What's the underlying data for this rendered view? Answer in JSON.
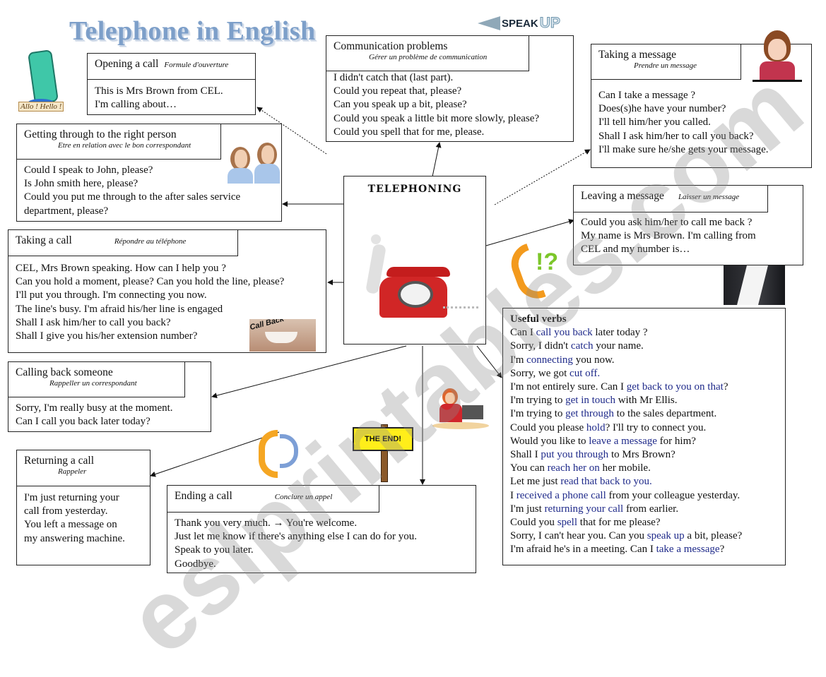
{
  "title": "Telephone in English",
  "mascot_label": "Allo ! Hello !",
  "speak_up": {
    "part1": "SPEAK",
    "part2": "UP"
  },
  "center": {
    "title": "TELEPHONING"
  },
  "call_back_label": "Call Back",
  "the_end_label": "THE END!",
  "watermark": "eslprintables.com",
  "sections": {
    "opening": {
      "title": "Opening a call",
      "french": "Formule d'ouverture",
      "lines": [
        "This is Mrs Brown from CEL.",
        "I'm calling about…"
      ]
    },
    "communication": {
      "title": "Communication problems",
      "french": "Gérer un problème de communication",
      "lines": [
        "I didn't catch that (last part).",
        "Could you repeat that, please?",
        "Can you speak up a bit, please?",
        "Could you speak a little bit more slowly, please?",
        "Could you spell that for me, please."
      ]
    },
    "taking_message": {
      "title": "Taking a message",
      "french": "Prendre un message",
      "lines": [
        "Can I take a message ?",
        "Does(s)he have your number?",
        "I'll tell him/her you called.",
        "Shall I ask him/her to call you back?",
        "I'll make sure he/she gets your message."
      ]
    },
    "getting_through": {
      "title": "Getting through to the right person",
      "french": "Etre en relation avec le bon correspondant",
      "lines": [
        "Could I speak to John, please?",
        "Is John smith here, please?",
        "Could you put me through to the after sales service",
        "department, please?"
      ]
    },
    "leaving_message": {
      "title": "Leaving a message",
      "french": "Laisser un message",
      "lines": [
        "Could you ask him/her to call me back ?",
        "My name is Mrs Brown. I'm calling from",
        "CEL and my number is…"
      ]
    },
    "taking_call": {
      "title": "Taking a call",
      "french": "Répondre au téléphone",
      "lines": [
        "CEL, Mrs Brown speaking. How can I help you ?",
        "Can you hold a moment, please? Can you hold the line, please?",
        "I'll put you through. I'm connecting you now.",
        "The line's busy. I'm afraid his/her line is engaged",
        "Shall I ask him/her to call you back?",
        "Shall I give you his/her extension number?"
      ]
    },
    "calling_back": {
      "title": "Calling back someone",
      "french": "Rappeller un correspondant",
      "lines": [
        "Sorry, I'm really busy at the moment.",
        "Can I call you back later today?"
      ]
    },
    "returning": {
      "title": "Returning a call",
      "french": "Rappeler",
      "lines": [
        "I'm just returning your",
        "call from yesterday.",
        "You left a message on",
        "my answering machine."
      ]
    },
    "ending": {
      "title": "Ending a call",
      "french": "Conclure un appel",
      "lines": [
        "Thank you very much. → You're welcome.",
        "Just let me know if there's anything else I can do for you.",
        "Speak to you later.",
        "Goodbye."
      ]
    },
    "useful_verbs": {
      "title": "Useful verbs",
      "lines": [
        {
          "pre": "Can I ",
          "hl": "call you back",
          "post": " later today ?"
        },
        {
          "pre": "Sorry, I didn't ",
          "hl": "catch",
          "post": " your name."
        },
        {
          "pre": "I'm ",
          "hl": "connecting",
          "post": " you now."
        },
        {
          "pre": "Sorry, we got ",
          "hl": "cut off.",
          "post": ""
        },
        {
          "pre": "I'm not entirely sure. Can I ",
          "hl": "get back to you on that",
          "post": "?"
        },
        {
          "pre": "I'm trying to ",
          "hl": "get in touch",
          "post": " with Mr Ellis."
        },
        {
          "pre": "I'm trying to ",
          "hl": "get through",
          "post": " to the sales department."
        },
        {
          "pre": "Could you please ",
          "hl": "hold",
          "post": "? I'll try to connect you."
        },
        {
          "pre": "Would you like to ",
          "hl": "leave a message",
          "post": " for him?"
        },
        {
          "pre": "Shall I ",
          "hl": "put you through",
          "post": " to Mrs Brown?"
        },
        {
          "pre": "You can ",
          "hl": "reach her on",
          "post": " her mobile."
        },
        {
          "pre": "Let me just ",
          "hl": "read that back to you.",
          "post": ""
        },
        {
          "pre": "I ",
          "hl": "received a phone call",
          "post": " from your colleague yesterday."
        },
        {
          "pre": "I'm just ",
          "hl": "returning your call",
          "post": " from earlier."
        },
        {
          "pre": "Could you ",
          "hl": "spell",
          "post": " that for me please?"
        },
        {
          "pre": "Sorry, I can't hear you. Can you ",
          "hl": "speak up",
          "post": " a bit, please?"
        },
        {
          "pre": "I'm afraid he's in a meeting. Can I ",
          "hl": "take a message",
          "post": "?"
        }
      ]
    }
  }
}
